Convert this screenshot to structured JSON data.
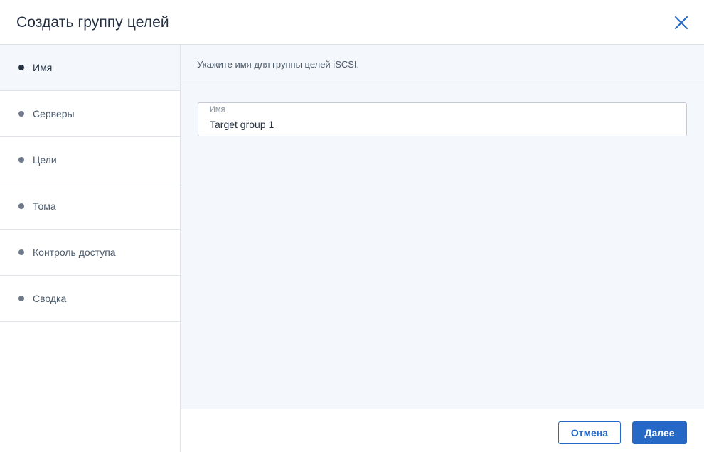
{
  "dialog": {
    "title": "Создать группу целей",
    "close_icon": "close-icon"
  },
  "steps": [
    {
      "label": "Имя",
      "active": true
    },
    {
      "label": "Серверы",
      "active": false
    },
    {
      "label": "Цели",
      "active": false
    },
    {
      "label": "Тома",
      "active": false
    },
    {
      "label": "Контроль доступа",
      "active": false
    },
    {
      "label": "Сводка",
      "active": false
    }
  ],
  "main": {
    "hint": "Укажите имя для группы целей iSCSI.",
    "name_field": {
      "label": "Имя",
      "value": "Target group 1"
    }
  },
  "footer": {
    "cancel_label": "Отмена",
    "next_label": "Далее"
  },
  "colors": {
    "accent": "#2668c5",
    "background_panel": "#f4f7fb",
    "border": "#dfe3e8",
    "text": "#243143"
  }
}
